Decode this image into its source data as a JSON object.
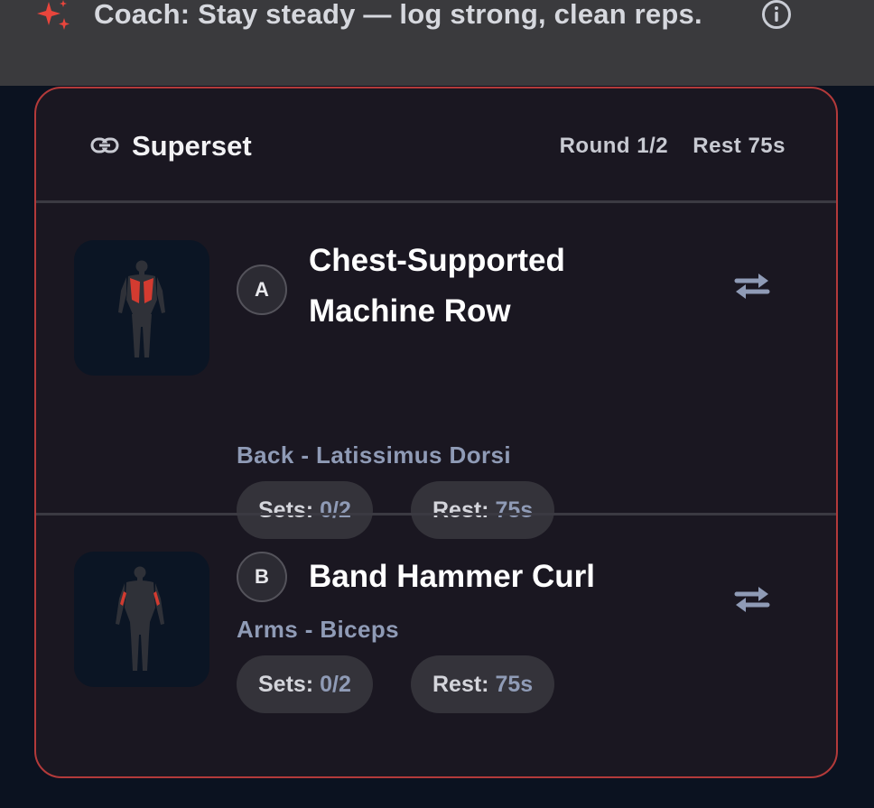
{
  "coach": {
    "message": "Coach: Stay steady — log strong, clean reps.",
    "icon": "sparkle-icon",
    "info_icon": "info-icon"
  },
  "superset": {
    "title": "Superset",
    "round": "Round 1/2",
    "rest": "Rest 75s",
    "accent": "#b33a3a",
    "exercises": [
      {
        "badge": "A",
        "name_line1": "Chest-Supported",
        "name_line2": "Machine Row",
        "muscle": "Back - Latissimus Dorsi",
        "sets_label": "Sets:",
        "sets_value": "0/2",
        "rest_label": "Rest:",
        "rest_value": "75s",
        "thumb": "back-muscle-figure"
      },
      {
        "badge": "B",
        "name": "Band Hammer Curl",
        "muscle": "Arms - Biceps",
        "sets_label": "Sets:",
        "sets_value": "0/2",
        "rest_label": "Rest:",
        "rest_value": "75s",
        "thumb": "arms-muscle-figure"
      }
    ]
  }
}
